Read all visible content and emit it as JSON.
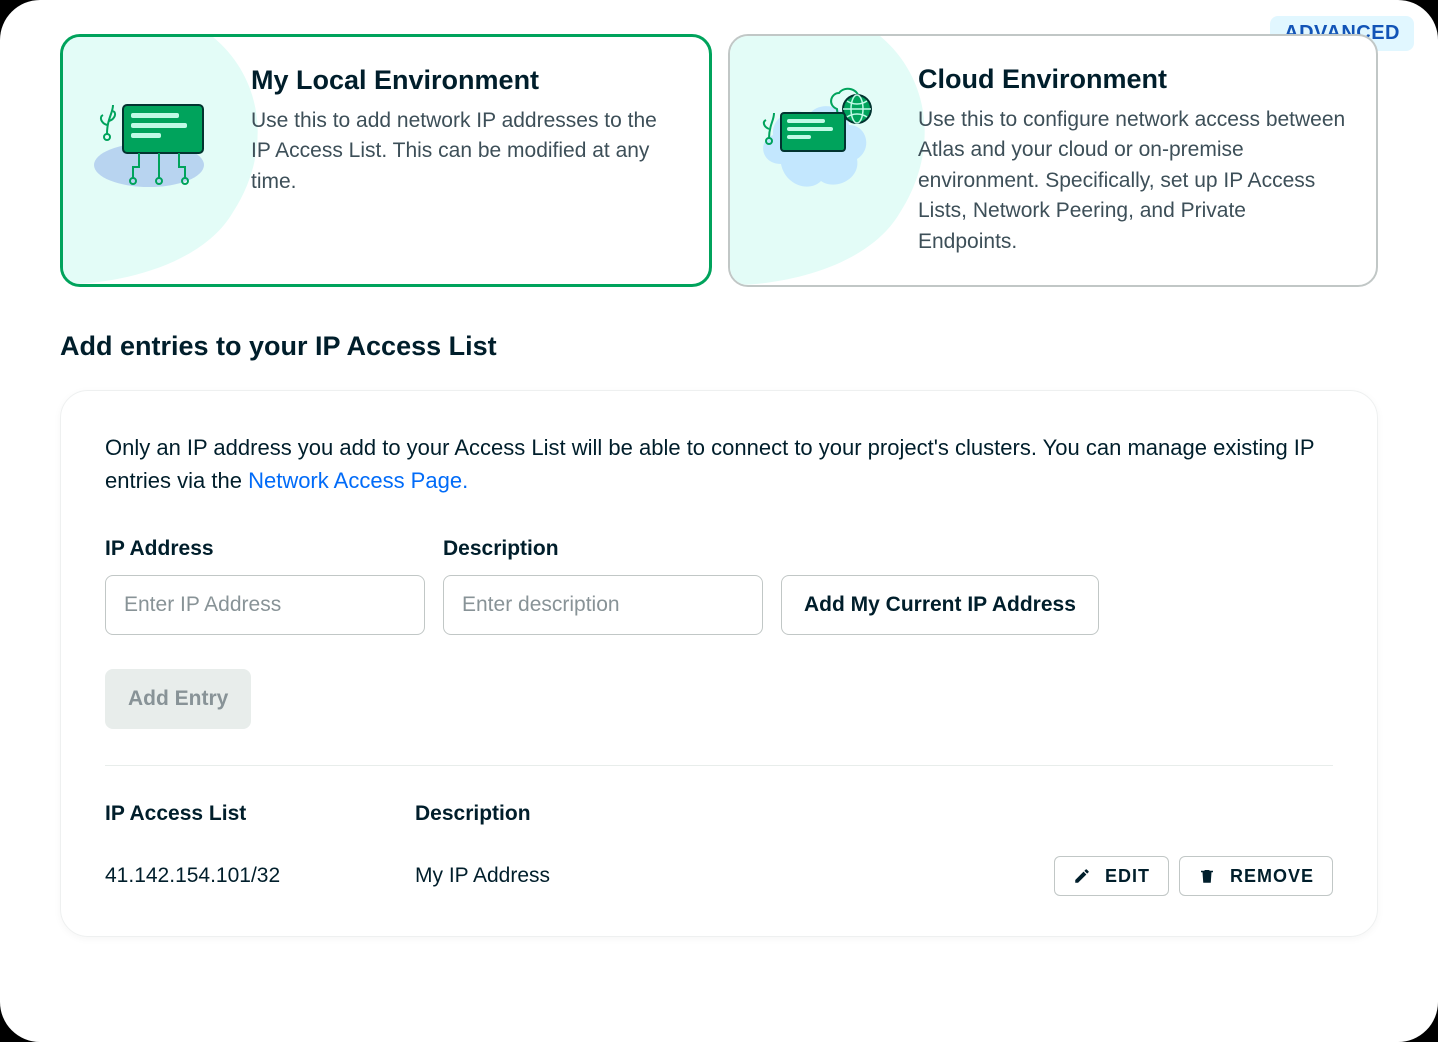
{
  "badge": "ADVANCED",
  "cards": {
    "local": {
      "title": "My Local Environment",
      "desc": "Use this to add network IP addresses to the IP Access List. This can be modified at any time."
    },
    "cloud": {
      "title": "Cloud Environment",
      "desc": "Use this to configure network access between Atlas and your cloud or on-premise environment. Specifically, set up IP Access Lists, Network Peering, and Private Endpoints."
    }
  },
  "section_title": "Add entries to your IP Access List",
  "panel": {
    "intro_text": "Only an IP address you add to your Access List will be able to connect to your project's clusters. You can manage existing IP entries via the ",
    "intro_link": "Network Access Page.",
    "labels": {
      "ip": "IP Address",
      "desc": "Description"
    },
    "placeholders": {
      "ip": "Enter IP Address",
      "desc": "Enter description"
    },
    "buttons": {
      "add_current": "Add My Current IP Address",
      "add_entry": "Add Entry",
      "edit": "EDIT",
      "remove": "REMOVE"
    },
    "list_headers": {
      "col1": "IP Access List",
      "col2": "Description"
    },
    "entries": [
      {
        "ip": "41.142.154.101/32",
        "desc": "My IP Address"
      }
    ]
  }
}
